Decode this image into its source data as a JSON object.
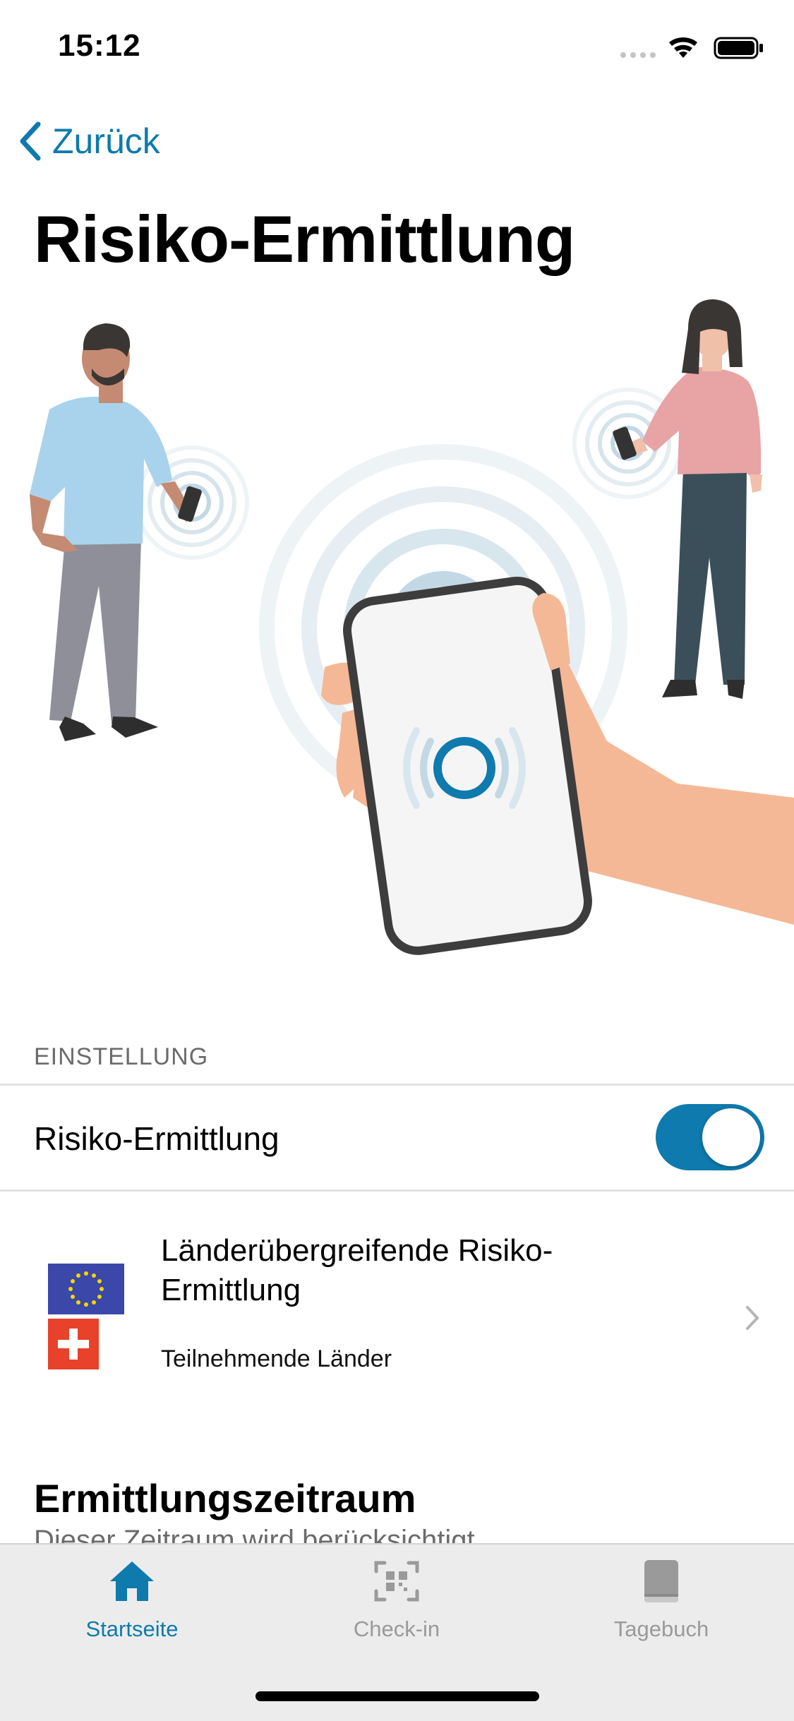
{
  "status_bar": {
    "time": "15:12"
  },
  "nav": {
    "back_label": "Zurück"
  },
  "page": {
    "title": "Risiko-Ermittlung"
  },
  "settings": {
    "section_header": "EINSTELLUNG",
    "toggle_label": "Risiko-Ermittlung",
    "toggle_on": true,
    "accent_color": "#0e7aad"
  },
  "international": {
    "title": "Länderübergreifende Risiko-Ermittlung",
    "subtitle": "Teilnehmende Länder",
    "flags": [
      "eu-flag-icon",
      "swiss-flag-icon"
    ]
  },
  "period": {
    "title": "Ermittlungszeitraum",
    "subtitle": "Dieser Zeitraum wird berücksichtigt"
  },
  "tabs": [
    {
      "label": "Startseite",
      "icon": "home-icon",
      "active": true
    },
    {
      "label": "Check-in",
      "icon": "qr-code-icon",
      "active": false
    },
    {
      "label": "Tagebuch",
      "icon": "book-icon",
      "active": false
    }
  ]
}
